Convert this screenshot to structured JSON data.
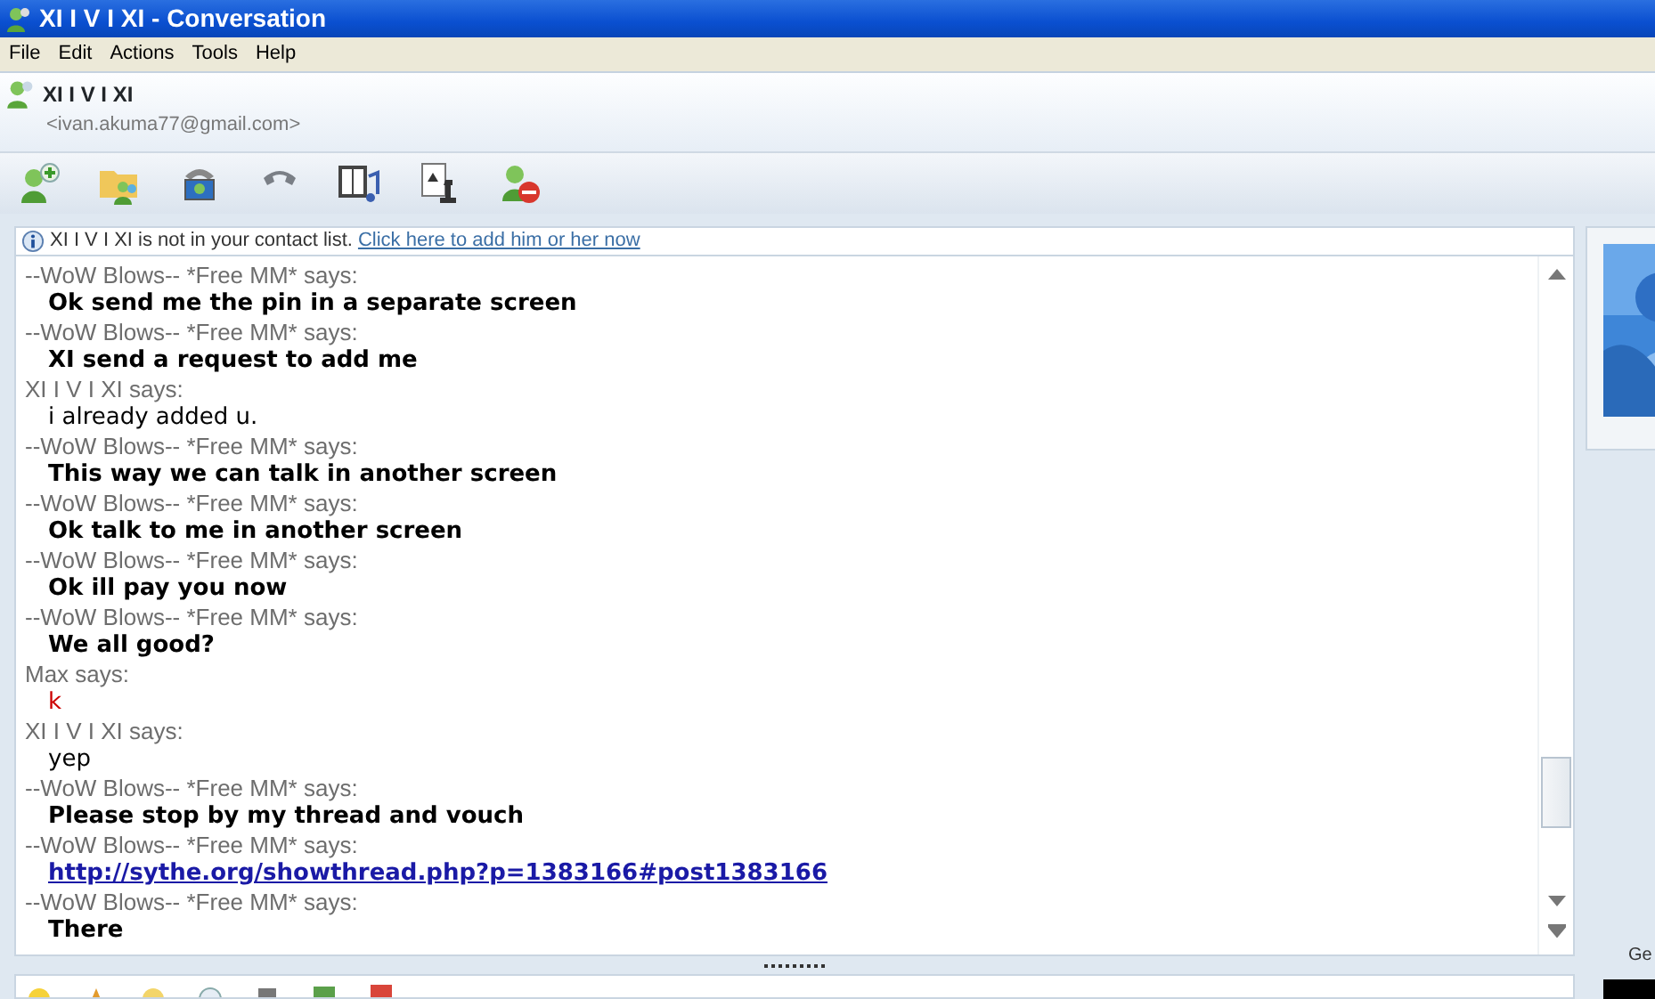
{
  "window": {
    "title": "XI I V I XI - Conversation"
  },
  "menu": [
    "File",
    "Edit",
    "Actions",
    "Tools",
    "Help"
  ],
  "contact": {
    "name": "XI I V I XI",
    "email": "<ivan.akuma77@gmail.com>"
  },
  "toolbar": [
    {
      "kind": "invite"
    },
    {
      "kind": "share"
    },
    {
      "kind": "video-call"
    },
    {
      "kind": "call"
    },
    {
      "kind": "media"
    },
    {
      "kind": "games"
    },
    {
      "kind": "block"
    }
  ],
  "notice": {
    "text": "XI I V I XI is not in your contact list.",
    "link": "Click here to add him or her now"
  },
  "messages": [
    {
      "sender": "--WoW Blows-- *Free MM* says:",
      "text": "Ok send me the pin in a separate screen",
      "kind": "bold",
      "color": "#000000"
    },
    {
      "sender": "--WoW Blows-- *Free MM* says:",
      "text": "XI send a request to add me",
      "kind": "bold",
      "color": "#000000"
    },
    {
      "sender": "XI I V I XI says:",
      "text": "i already added u.",
      "kind": "plain",
      "color": "#000000"
    },
    {
      "sender": "--WoW Blows-- *Free MM* says:",
      "text": "This way we can talk in another screen",
      "kind": "bold",
      "color": "#000000"
    },
    {
      "sender": "--WoW Blows-- *Free MM* says:",
      "text": "Ok talk to me in another screen",
      "kind": "bold",
      "color": "#000000"
    },
    {
      "sender": "--WoW Blows-- *Free MM* says:",
      "text": "Ok ill pay you now",
      "kind": "bold",
      "color": "#000000"
    },
    {
      "sender": "--WoW Blows-- *Free MM* says:",
      "text": "We all good?",
      "kind": "bold",
      "color": "#000000"
    },
    {
      "sender": "Max says:",
      "text": "k",
      "kind": "plain",
      "color": "#cc0000"
    },
    {
      "sender": "XI I V I XI says:",
      "text": "yep",
      "kind": "plain",
      "color": "#000000"
    },
    {
      "sender": "--WoW Blows-- *Free MM* says:",
      "text": "Please stop by my thread and vouch",
      "kind": "bold",
      "color": "#000000"
    },
    {
      "sender": "--WoW Blows-- *Free MM* says:",
      "text": "http://sythe.org/showthread.php?p=1383166#post1383166",
      "kind": "link",
      "color": "#1a1aa6"
    },
    {
      "sender": "--WoW Blows-- *Free MM* says:",
      "text": "There",
      "kind": "bold",
      "color": "#000000"
    }
  ],
  "side_label": "Ge"
}
